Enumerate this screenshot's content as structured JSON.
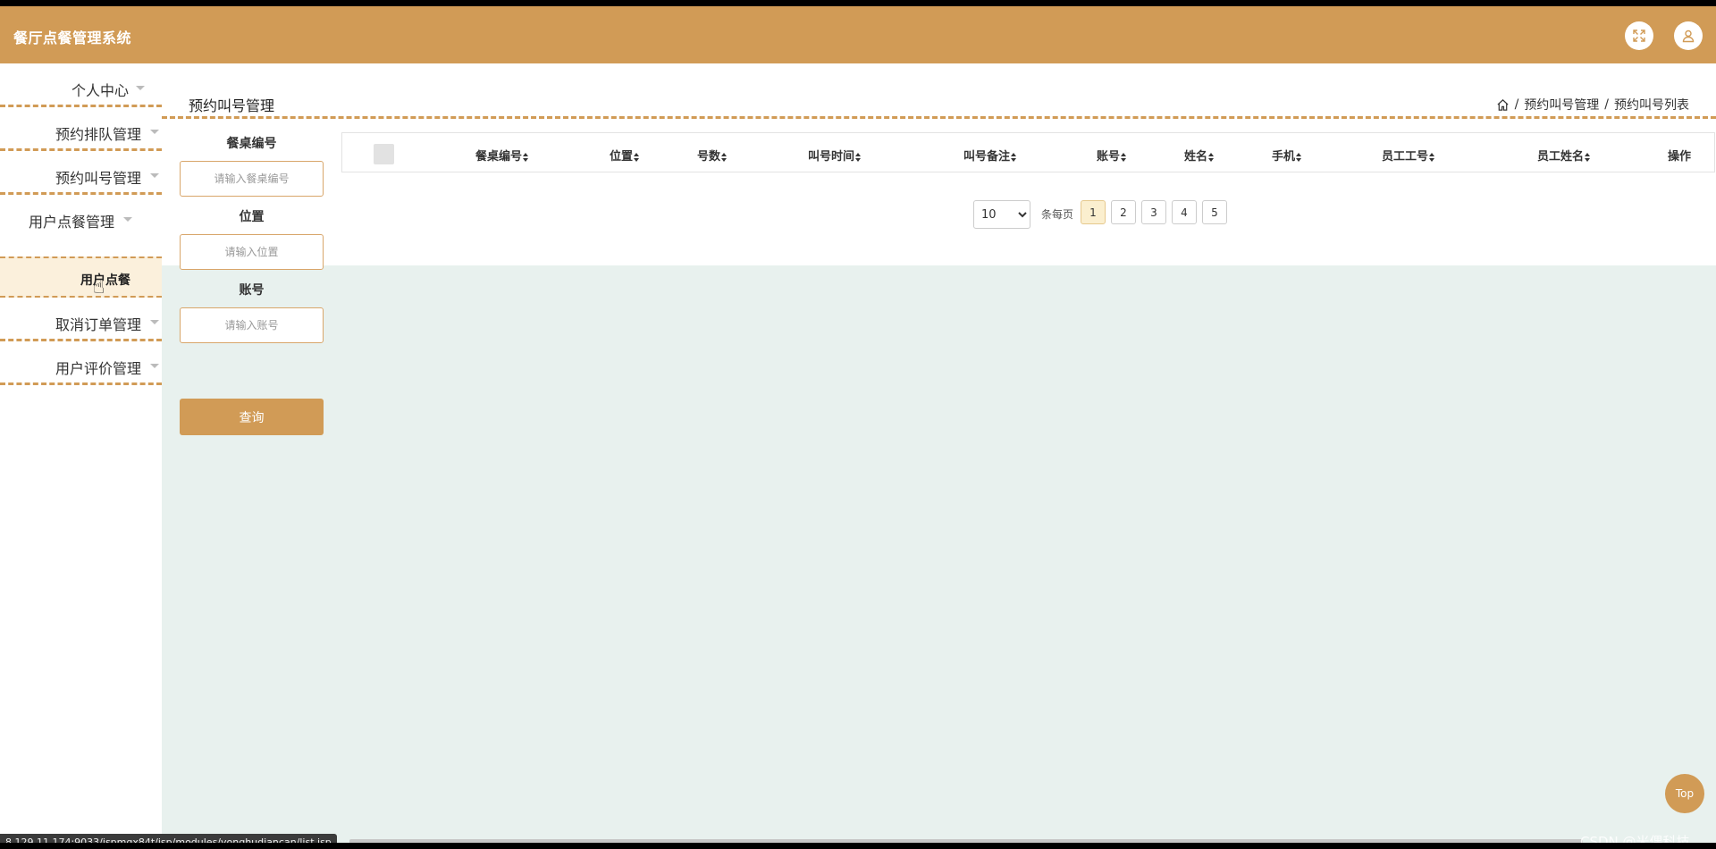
{
  "app": {
    "title": "餐厅点餐管理系统"
  },
  "header": {
    "fullscreen_icon": "fullscreen-icon",
    "user_icon": "user-icon"
  },
  "sidebar": {
    "items": [
      {
        "label": "个人中心"
      },
      {
        "label": "预约排队管理"
      },
      {
        "label": "预约叫号管理"
      },
      {
        "label": "用户点餐管理"
      },
      {
        "label": "取消订单管理"
      },
      {
        "label": "用户评价管理"
      }
    ],
    "active_sub": "用户点餐"
  },
  "page": {
    "title": "预约叫号管理",
    "breadcrumb": [
      "预约叫号管理",
      "预约叫号列表"
    ],
    "breadcrumb_sep": "/"
  },
  "search": {
    "fields": [
      {
        "label": "餐桌编号",
        "placeholder": "请输入餐桌编号",
        "value": ""
      },
      {
        "label": "位置",
        "placeholder": "请输入位置",
        "value": ""
      },
      {
        "label": "账号",
        "placeholder": "请输入账号",
        "value": ""
      }
    ],
    "button": "查询"
  },
  "table": {
    "columns": [
      "餐桌编号",
      "位置",
      "号数",
      "叫号时间",
      "叫号备注",
      "账号",
      "姓名",
      "手机",
      "员工工号",
      "员工姓名"
    ],
    "action_header": "操作",
    "rows": []
  },
  "pagination": {
    "page_size": "10",
    "page_size_options": [
      "10"
    ],
    "per_page_label": "条每页",
    "pages": [
      "1",
      "2",
      "3",
      "4",
      "5"
    ],
    "current": "1"
  },
  "top_button": "Top",
  "status_url": "8.129.11.174:9033/jspmgx84t/jsp/modules/yonghudiancan/list.jsp",
  "watermark": "CSDN @米偶科技",
  "colors": {
    "brand": "#d19b56",
    "content_bg": "#e8f1ee",
    "active_bg": "#fbf0dc"
  }
}
